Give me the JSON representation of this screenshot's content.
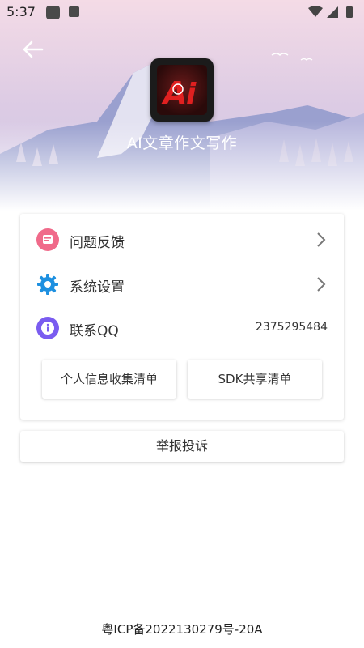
{
  "status_bar": {
    "time": "5:37"
  },
  "header": {
    "app_title": "AI文章作文写作"
  },
  "menu": [
    {
      "label": "问题反馈",
      "icon": "feedback-icon"
    },
    {
      "label": "系统设置",
      "icon": "gear-icon"
    },
    {
      "label": "联系QQ",
      "icon": "info-icon",
      "value": "2375295484"
    }
  ],
  "buttons": {
    "personal_info": "个人信息收集清单",
    "sdk_share": "SDK共享清单"
  },
  "report_label": "举报投诉",
  "footer_icp": "粤ICP备2022130279号-20A",
  "colors": {
    "feedback_icon": "#f06a8a",
    "gear_icon": "#1e90e0",
    "info_icon": "#7a5cf0"
  }
}
